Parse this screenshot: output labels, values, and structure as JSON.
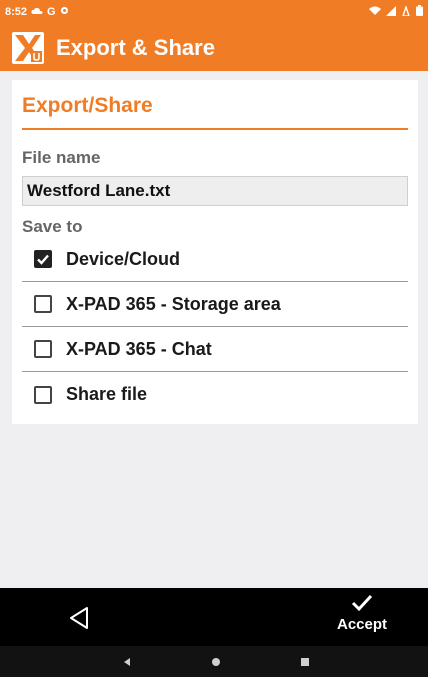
{
  "status_bar": {
    "time": "8:52",
    "left_glyphs": [
      "G"
    ],
    "icons": [
      "cloud-icon",
      "google-icon",
      "settings-icon",
      "wifi-icon",
      "signal-icon",
      "battery-icon"
    ]
  },
  "app_bar": {
    "title": "Export & Share",
    "logo_icon": "xpad-logo-icon"
  },
  "card": {
    "title": "Export/Share",
    "file_name_label": "File name",
    "file_name_value": "Westford Lane.txt",
    "save_to_label": "Save to",
    "options": [
      {
        "label": "Device/Cloud",
        "checked": true
      },
      {
        "label": "X-PAD 365 - Storage area",
        "checked": false
      },
      {
        "label": "X-PAD 365 - Chat",
        "checked": false
      },
      {
        "label": "Share file",
        "checked": false
      }
    ]
  },
  "bottom_bar": {
    "back_icon": "back-triangle-icon",
    "accept_icon": "checkmark-icon",
    "accept_label": "Accept"
  },
  "system_nav": {
    "icons": [
      "nav-back-icon",
      "nav-home-icon",
      "nav-recents-icon"
    ]
  },
  "colors": {
    "accent": "#f07d26",
    "background": "#efeff1",
    "card": "#ffffff",
    "bottom_bar": "#000000"
  }
}
